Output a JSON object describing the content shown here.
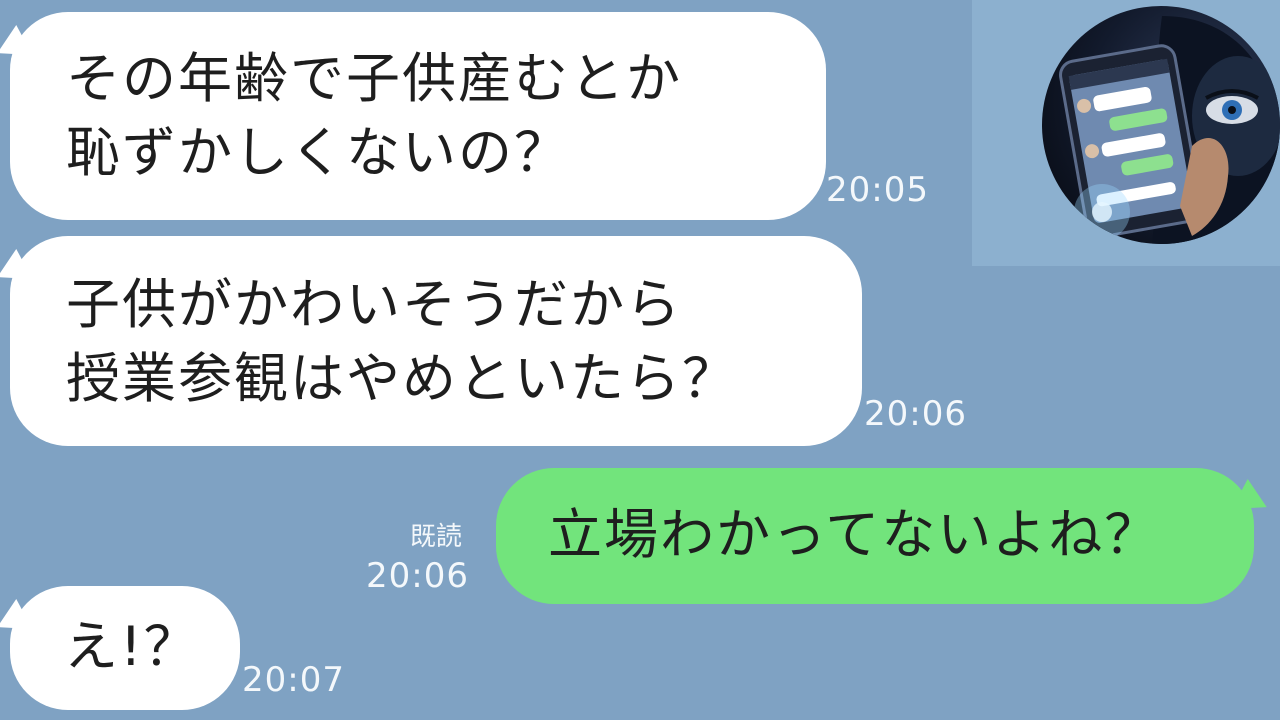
{
  "messages": [
    {
      "side": "in",
      "lines": [
        "その年齢で子供産むとか",
        "恥ずかしくないの？"
      ],
      "time": "20:05"
    },
    {
      "side": "in",
      "lines": [
        "子供がかわいそうだから",
        "授業参観はやめといたら？"
      ],
      "time": "20:06"
    },
    {
      "side": "out",
      "lines": [
        "立場わかってないよね？"
      ],
      "time": "20:06",
      "read": "既読"
    },
    {
      "side": "in",
      "lines": [
        "え!？"
      ],
      "time": "20:07"
    }
  ],
  "colors": {
    "background": "#7fa2c3",
    "incoming_bubble": "#ffffff",
    "outgoing_bubble": "#72e47c",
    "timestamp": "#f4f8fb"
  },
  "avatar": {
    "icon": "hooded-figure-with-phone-avatar"
  }
}
